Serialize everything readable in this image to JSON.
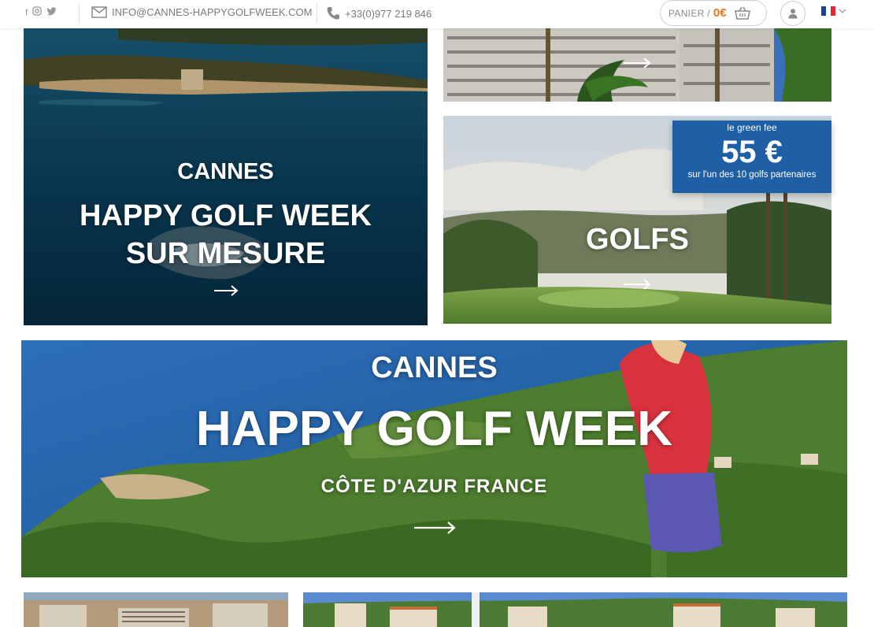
{
  "topbar": {
    "social_icons": [
      "facebook-icon",
      "instagram-icon",
      "twitter-icon"
    ],
    "email": "INFO@CANNES-HAPPYGOLFWEEK.COM",
    "phone": "+33(0)977 219 846",
    "cart_label": "PANIER /",
    "cart_amount": "0€",
    "language": "FR"
  },
  "tiles": {
    "cannes_sur_mesure": {
      "kicker": "CANNES",
      "title_line1": "HAPPY GOLF WEEK",
      "title_line2": "SUR MESURE",
      "arrow": "⟶"
    },
    "hotel": {
      "arrow": "⟶"
    },
    "golfs": {
      "title": "GOLFS",
      "arrow": "⟶",
      "promo": {
        "label": "le green fee",
        "price": "55 €",
        "caption": "sur l'un des 10 golfs partenaires"
      }
    },
    "hero": {
      "kicker": "CANNES",
      "title": "HAPPY GOLF WEEK",
      "subtitle": "CÔTE D'AZUR FRANCE",
      "arrow": "⟶"
    }
  },
  "colors": {
    "accent_orange": "#e8731a",
    "promo_blue": "#1f5fa6"
  }
}
